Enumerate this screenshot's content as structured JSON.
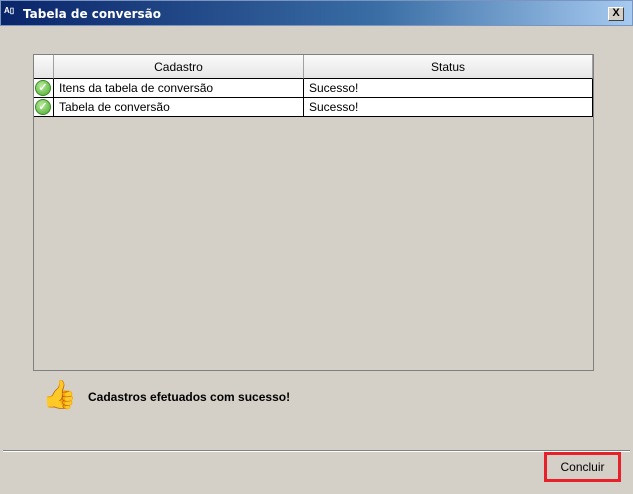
{
  "window": {
    "title": "Tabela de conversão",
    "close_label": "X"
  },
  "grid": {
    "columns": [
      "Cadastro",
      "Status"
    ],
    "rows": [
      {
        "icon": "success-check-icon",
        "cadastro": "Itens da tabela de conversão",
        "status": "Sucesso!"
      },
      {
        "icon": "success-check-icon",
        "cadastro": "Tabela de conversão",
        "status": "Sucesso!"
      }
    ]
  },
  "message": {
    "icon": "thumbs-up-icon",
    "text": "Cadastros efetuados com sucesso!"
  },
  "footer": {
    "finish_label": "Concluir",
    "highlight_color": "#e8202a"
  }
}
